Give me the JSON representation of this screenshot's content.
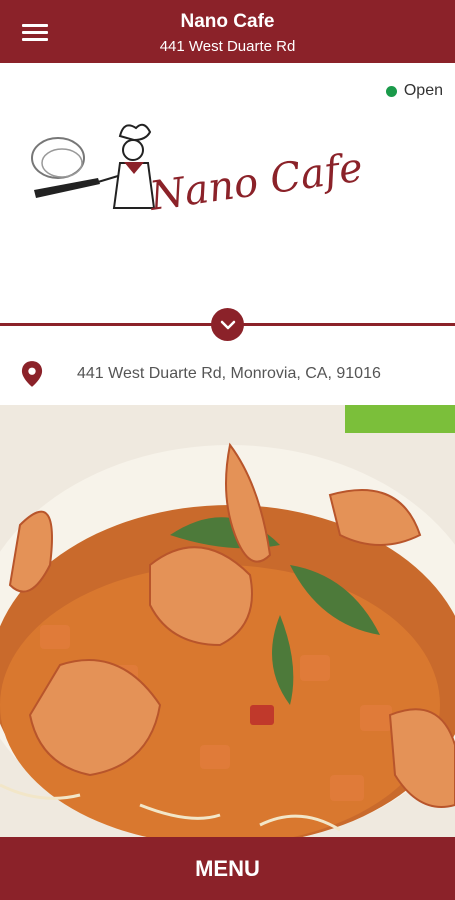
{
  "header": {
    "title": "Nano Cafe",
    "subtitle": "441 West Duarte Rd"
  },
  "status": {
    "label": "Open",
    "color": "#1a9a4a"
  },
  "logo": {
    "text": "Nano Cafe"
  },
  "location": {
    "address": "441 West Duarte Rd, Monrovia, CA, 91016"
  },
  "menu": {
    "label": "MENU"
  },
  "colors": {
    "brand": "#8b2229"
  },
  "icons": {
    "menu": "hamburger-icon",
    "expand": "chevron-down-icon",
    "location": "map-pin-icon"
  }
}
